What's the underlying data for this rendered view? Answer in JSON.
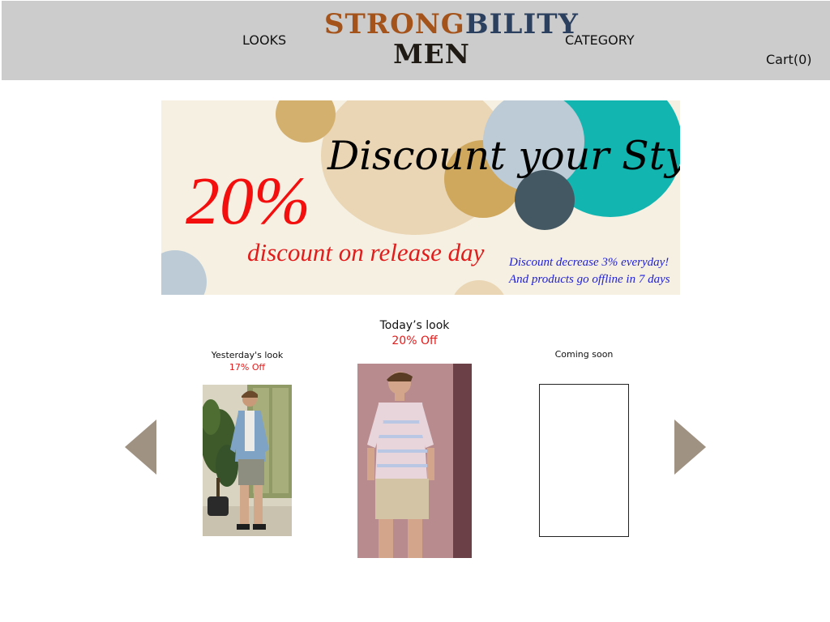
{
  "header": {
    "logo_part1": "STRONG",
    "logo_part2": "BILITY",
    "logo_part3": "MEN",
    "nav_looks": "LOOKS",
    "nav_category": "CATEGORY",
    "cart": "Cart(0)"
  },
  "banner": {
    "headline": "Discount your Style!",
    "percent": "20%",
    "subtitle": "discount on release day",
    "note_line1": "Discount decrease 3% everyday!",
    "note_line2": "And products go offline in 7 days"
  },
  "looks": {
    "yesterday": {
      "title": "Yesterday's look",
      "discount": "17% Off"
    },
    "today": {
      "title": "Today’s look",
      "discount": "20% Off"
    },
    "coming": {
      "title": "Coming soon"
    }
  },
  "colors": {
    "header_bg": "#cccccc",
    "logo_brown": "#a4531a",
    "logo_navy": "#2b3f5e",
    "discount_red": "#e21b1b",
    "note_blue": "#1f1fd6",
    "arrow": "#a09282"
  },
  "icons": {
    "prev": "triangle-left-arrow",
    "next": "triangle-right-arrow"
  }
}
